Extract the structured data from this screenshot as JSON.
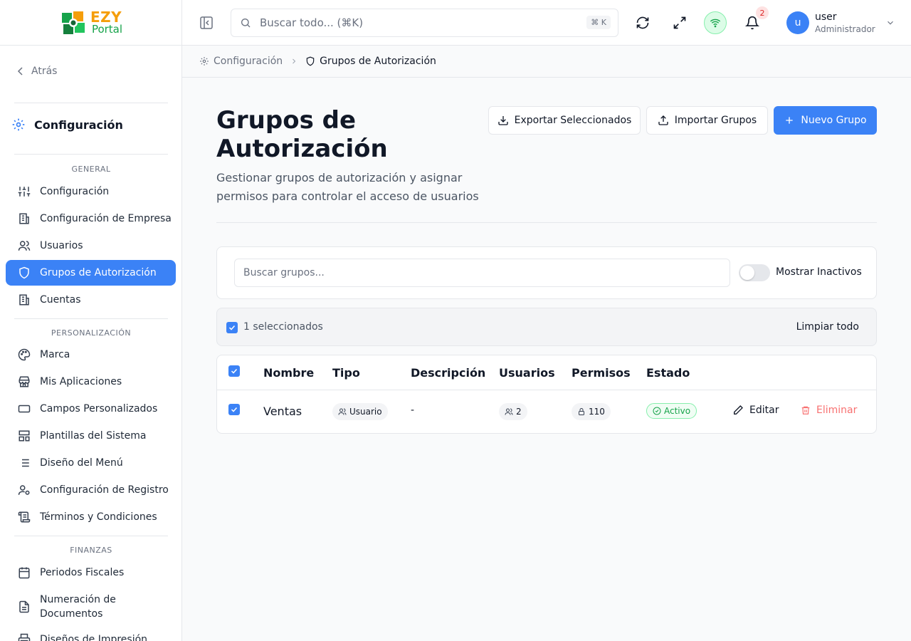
{
  "brand": {
    "name": "EZY",
    "sub": "Portal"
  },
  "sidebar": {
    "back_label": "Atrás",
    "section_title": "Configuración",
    "groups": [
      {
        "label": "GENERAL",
        "items": [
          "Configuración",
          "Configuración de Empresa",
          "Usuarios",
          "Grupos de Autorización",
          "Cuentas"
        ]
      },
      {
        "label": "PERSONALIZACIÓN",
        "items": [
          "Marca",
          "Mis Aplicaciones",
          "Campos Personalizados",
          "Plantillas del Sistema",
          "Diseño del Menú",
          "Configuración de Registro",
          "Términos y Condiciones"
        ]
      },
      {
        "label": "FINANZAS",
        "items": [
          "Periodos Fiscales",
          "Numeración de Documentos",
          "Diseños de Impresión"
        ]
      }
    ],
    "active_item": "Grupos de Autorización"
  },
  "topbar": {
    "search_placeholder": "Buscar todo... (⌘K)",
    "shortcut": "⌘ K",
    "notification_count": "2",
    "user": {
      "initial": "u",
      "name": "user",
      "role": "Administrador"
    }
  },
  "breadcrumb": [
    "Configuración",
    "Grupos de Autorización"
  ],
  "page": {
    "title": "Grupos de Autorización",
    "subtitle": "Gestionar grupos de autorización y asignar permisos para controlar el acceso de usuarios",
    "buttons": {
      "export": "Exportar Seleccionados",
      "import": "Importar Grupos",
      "new": "Nuevo Grupo"
    }
  },
  "filters": {
    "search_placeholder": "Buscar grupos...",
    "toggle_label": "Mostrar Inactivos",
    "toggle_on": false
  },
  "selection": {
    "count_label": "1 seleccionados",
    "clear_label": "Limpiar todo"
  },
  "table": {
    "columns": [
      "Nombre",
      "Tipo",
      "Descripción",
      "Usuarios",
      "Permisos",
      "Estado"
    ],
    "rows": [
      {
        "name": "Ventas",
        "type": "Usuario",
        "description": "-",
        "users": "2",
        "permissions": "110",
        "status": "Activo",
        "edit": "Editar",
        "delete": "Eliminar",
        "checked": true
      }
    ]
  },
  "colors": {
    "primary": "#3b82f6",
    "success": "#16a34a",
    "danger": "#f87171",
    "brand_orange": "#f59e0b",
    "brand_green": "#16a34a"
  }
}
